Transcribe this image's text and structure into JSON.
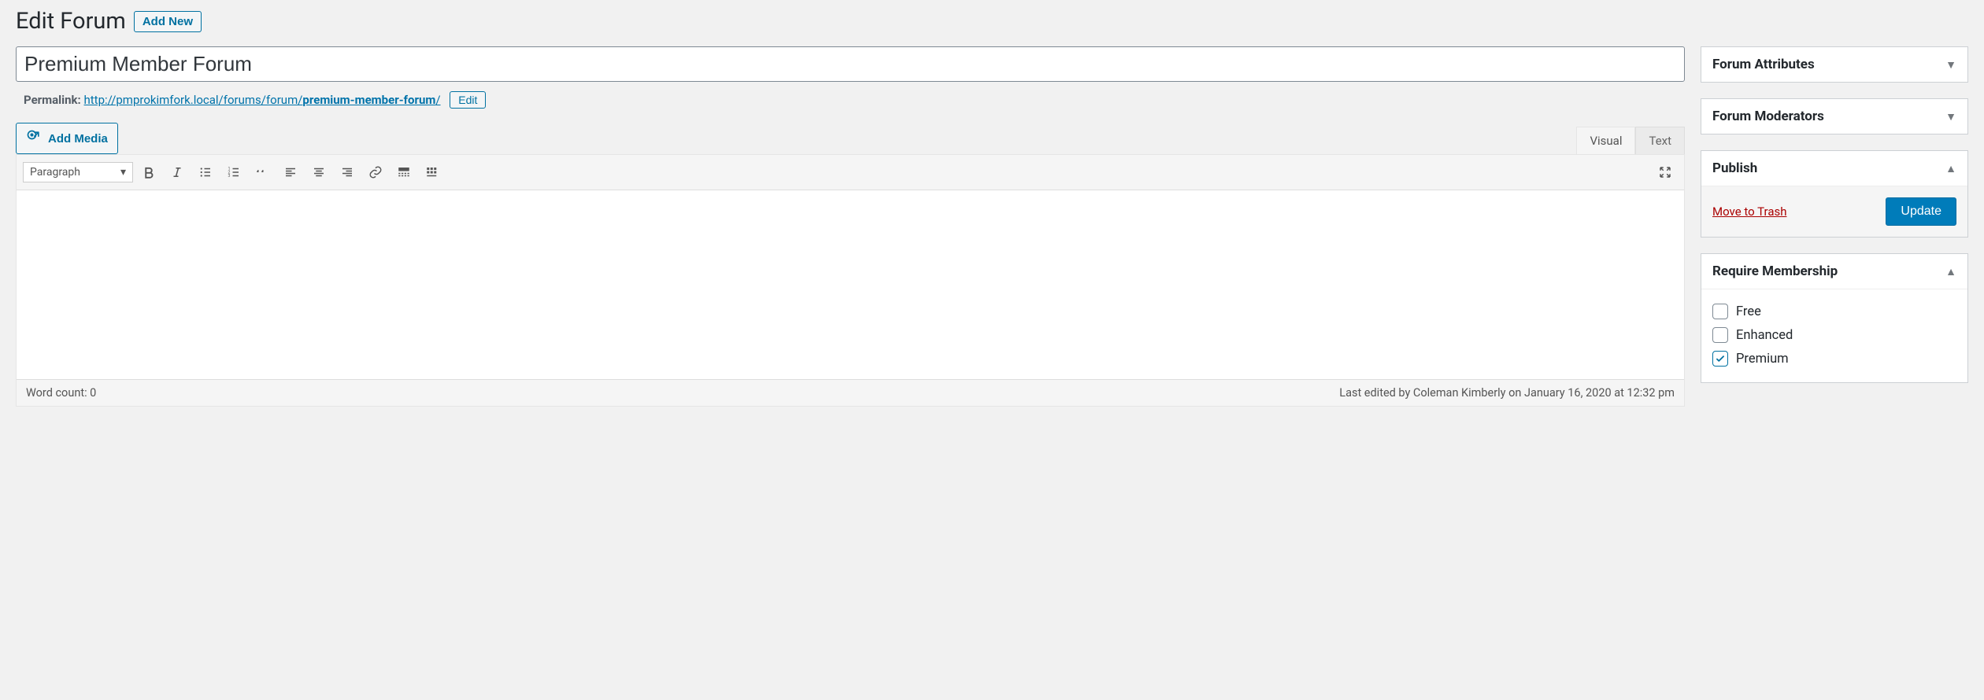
{
  "header": {
    "page_title": "Edit Forum",
    "add_new_label": "Add New"
  },
  "post": {
    "title": "Premium Member Forum",
    "permalink_label": "Permalink:",
    "permalink_base": "http://pmprokimfork.local/forums/forum/",
    "permalink_slug": "premium-member-forum",
    "permalink_trailing": "/",
    "edit_slug_label": "Edit"
  },
  "editor": {
    "add_media_label": "Add Media",
    "tabs": {
      "visual": "Visual",
      "text": "Text"
    },
    "format_dropdown": "Paragraph",
    "word_count_label": "Word count: 0",
    "last_edited": "Last edited by Coleman Kimberly on January 16, 2020 at 12:32 pm"
  },
  "sidebar": {
    "forum_attributes_title": "Forum Attributes",
    "forum_moderators_title": "Forum Moderators",
    "publish": {
      "title": "Publish",
      "trash_label": "Move to Trash",
      "update_label": "Update"
    },
    "require_membership": {
      "title": "Require Membership",
      "options": [
        {
          "label": "Free",
          "checked": false
        },
        {
          "label": "Enhanced",
          "checked": false
        },
        {
          "label": "Premium",
          "checked": true
        }
      ]
    }
  }
}
